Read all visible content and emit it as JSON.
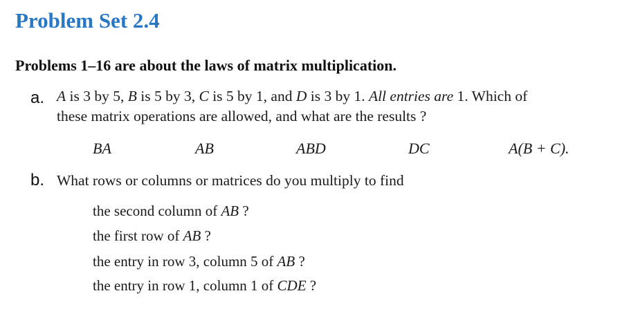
{
  "heading": "Problem Set 2.4",
  "intro": "Problems 1–16 are about the laws of matrix multiplication.",
  "problem_a": {
    "marker": "a.",
    "line1": {
      "v1": "A",
      "t1": " is 3 by 5, ",
      "v2": "B",
      "t2": " is 5 by 3, ",
      "v3": "C",
      "t3": " is 5 by 1, and ",
      "v4": "D",
      "t4": " is 3 by 1. ",
      "emph": "All entries are",
      "t5": " 1. Which of"
    },
    "line2": "these matrix operations are allowed, and what are the results ?",
    "expressions": [
      "BA",
      "AB",
      "ABD",
      "DC",
      "A(B + C)."
    ]
  },
  "problem_b": {
    "marker": "b.",
    "prompt": "What rows or columns or matrices do you multiply to find",
    "items": [
      {
        "text": "the second column of ",
        "var": "AB",
        "end": " ?"
      },
      {
        "text": "the first row of ",
        "var": "AB",
        "end": " ?"
      },
      {
        "text": "the entry in row 3, column 5 of ",
        "var": "AB",
        "end": " ?"
      },
      {
        "text": "the entry in row 1, column 1 of ",
        "var": "CDE",
        "end": " ?"
      }
    ]
  }
}
